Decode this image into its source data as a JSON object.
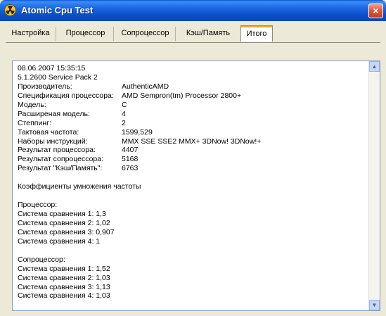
{
  "window": {
    "title": "Atomic Cpu Test",
    "close_label": "×"
  },
  "tabs": [
    {
      "label": "Настройка"
    },
    {
      "label": "Процессор"
    },
    {
      "label": "Сопроцессор"
    },
    {
      "label": "Кэш/Память"
    },
    {
      "label": "Итого",
      "active": true
    }
  ],
  "report": {
    "datetime": "08.06.2007  15:35:15",
    "os": "5.1.2600  Service Pack 2",
    "fields": [
      {
        "label": "Производитель:",
        "value": "AuthenticAMD"
      },
      {
        "label": "Спецификация процессора:",
        "value": "AMD Sempron(tm) Processor 2800+"
      },
      {
        "label": "Модель:",
        "value": "C"
      },
      {
        "label": "Расширеная модель:",
        "value": "4"
      },
      {
        "label": "Степпинг:",
        "value": "2"
      },
      {
        "label": "Тактовая частота:",
        "value": "1599,529"
      },
      {
        "label": "Наборы инструкций:",
        "value": "MMX  SSE  SSE2  MMX+  3DNow!  3DNow!+"
      },
      {
        "label": "Результат процессора:",
        "value": "4407"
      },
      {
        "label": "Результат сопроцессора:",
        "value": "5168"
      },
      {
        "label": "Результат \"Кэш/Память\":",
        "value": "6763"
      }
    ],
    "multipliers_heading": "Коэффициенты умножения частоты",
    "cpu_heading": "Процессор:",
    "cpu_lines": [
      "Система сравнения 1: 1,3",
      "Система сравнения 2: 1,02",
      "Система сравнения 3: 0,907",
      "Система сравнения 4: 1"
    ],
    "fpu_heading": "Сопроцессор:",
    "fpu_lines": [
      "Система сравнения 1: 1,52",
      "Система сравнения 2: 1,03",
      "Система сравнения 3: 1,13",
      "Система сравнения 4: 1,03"
    ]
  },
  "colors": {
    "titlebar": "#0a50c8",
    "active_tab_accent": "#e6a93a",
    "window_bg": "#ece9d8"
  },
  "icons": {
    "app": "radiation-icon",
    "close": "close-icon"
  }
}
